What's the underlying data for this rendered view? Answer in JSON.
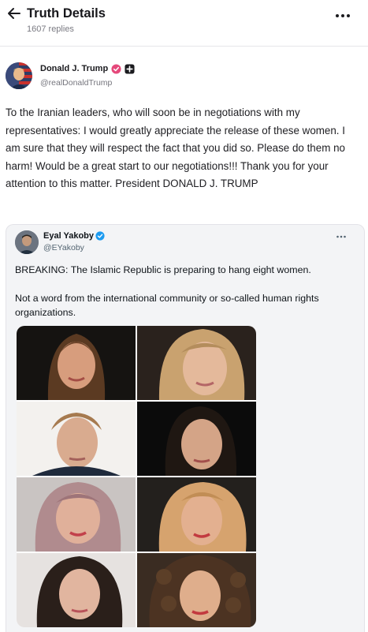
{
  "header": {
    "title": "Truth Details",
    "replies": "1607 replies"
  },
  "post": {
    "author_name": "Donald J. Trump",
    "author_handle": "@realDonaldTrump",
    "text": "To the Iranian leaders, who will soon be in negotiations with my representatives: I would greatly appreciate the release of these women. I am sure that they will respect the fact that you did so. Please do them no harm! Would be a great start to our negotiations!!! Thank you for your attention to this matter. President DONALD J. TRUMP"
  },
  "quote": {
    "author_name": "Eyal Yakoby",
    "author_handle": "@EYakoby",
    "text_1": "BREAKING: The Islamic Republic is preparing to hang eight women.",
    "text_2": "Not a word from the international community or so-called human rights organizations."
  },
  "colors": {
    "truth_verified": "#e5497b",
    "x_verified": "#1d9bf0",
    "quote_background": "#f3f4f6"
  },
  "icons": [
    "back-arrow-icon",
    "more-icon",
    "verified-icon",
    "plus-badge-icon",
    "x-verified-icon"
  ]
}
